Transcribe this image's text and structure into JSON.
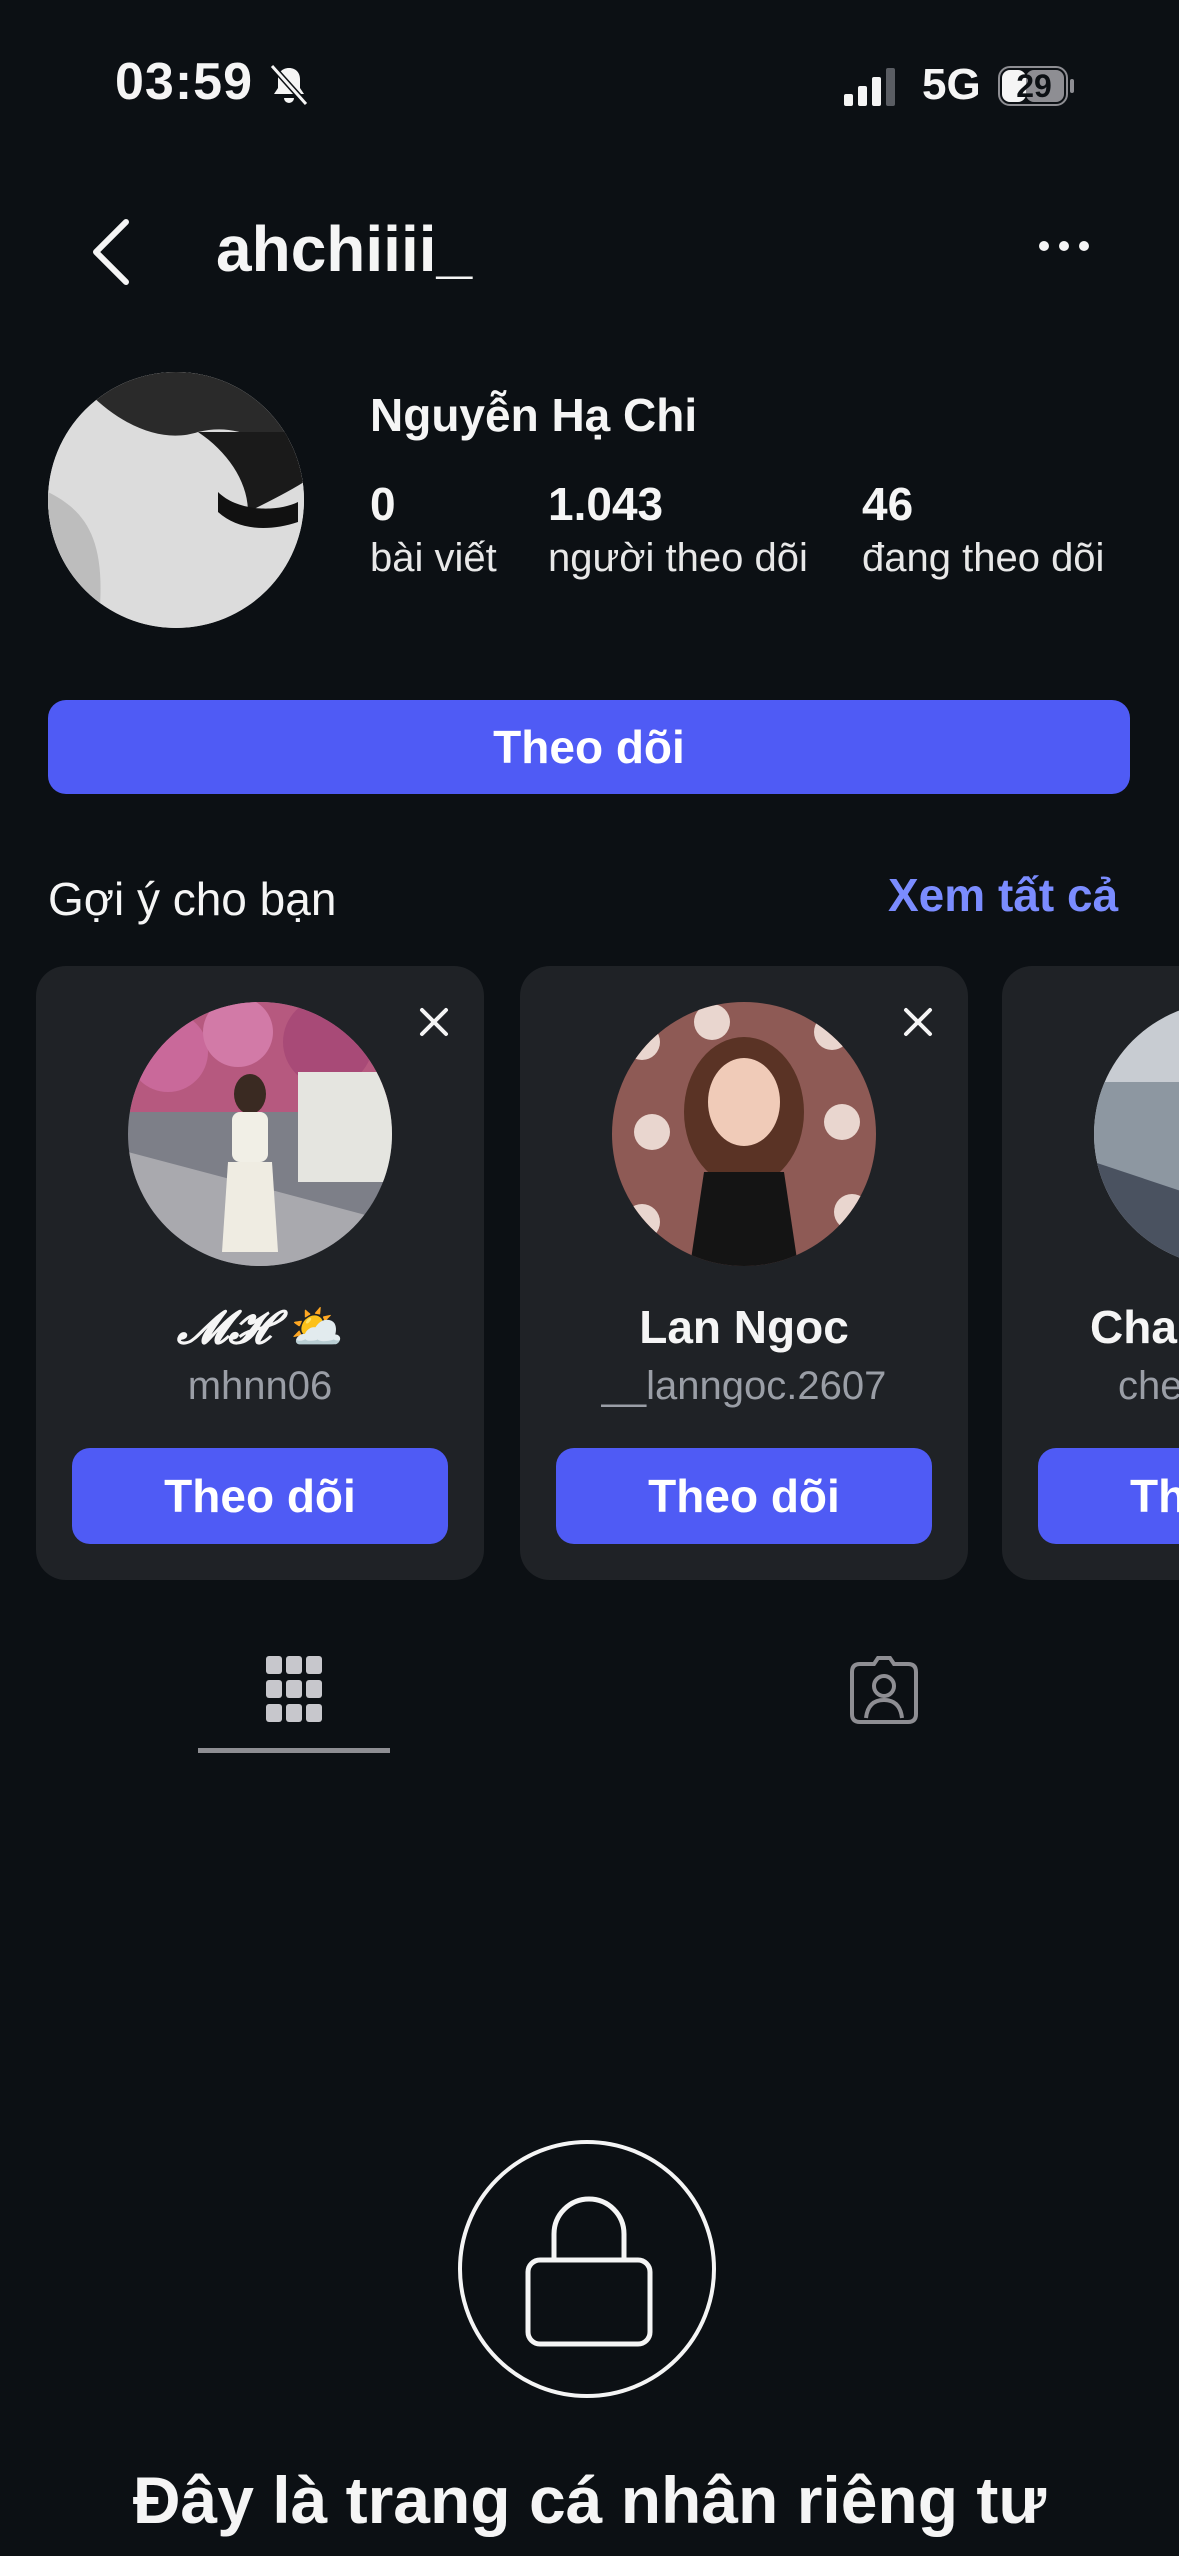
{
  "status_bar": {
    "time": "03:59",
    "network": "5G",
    "battery": "29"
  },
  "header": {
    "username": "ahchiiii_"
  },
  "profile": {
    "full_name": "Nguyễn Hạ Chi",
    "stats": [
      {
        "value": "0",
        "label": "bài viết"
      },
      {
        "value": "1.043",
        "label": "người theo dõi"
      },
      {
        "value": "46",
        "label": "đang theo dõi"
      }
    ],
    "follow_label": "Theo dõi"
  },
  "suggestions": {
    "title": "Gợi ý cho bạn",
    "see_all": "Xem tất cả",
    "cards": [
      {
        "name": "𝓜𝓗 ⛅",
        "handle": "mhnn06",
        "button": "Theo dõi"
      },
      {
        "name": "Lan Ngoc",
        "handle": "__lanngoc.2607",
        "button": "Theo dõi"
      },
      {
        "name": "Cha",
        "handle": "che",
        "button": "Th"
      }
    ]
  },
  "tabs": {
    "active": "grid",
    "icons": [
      "grid-icon",
      "tagged-icon"
    ]
  },
  "private": {
    "message": "Đây là trang cá nhân riêng tư"
  },
  "colors": {
    "background": "#0c1014",
    "accent": "#4f5bf5",
    "link": "#7b8cff",
    "card": "#1f2226"
  }
}
